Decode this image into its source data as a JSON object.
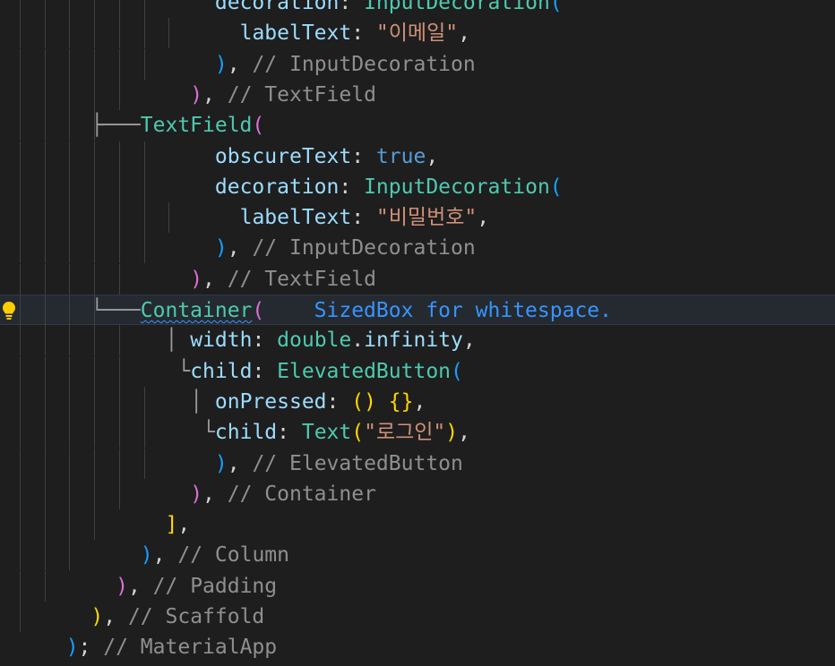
{
  "lines": [
    {
      "indent": 8,
      "guides": [
        1,
        2,
        3,
        4,
        5,
        6
      ],
      "tokens": [
        [
          "k",
          "decoration"
        ],
        [
          "p",
          ": "
        ],
        [
          "t",
          "InputDecoration"
        ],
        [
          "bl",
          "("
        ]
      ]
    },
    {
      "indent": 9,
      "guides": [
        1,
        2,
        3,
        4,
        5,
        6,
        7
      ],
      "tokens": [
        [
          "k",
          "labelText"
        ],
        [
          "p",
          ": "
        ],
        [
          "s",
          "\"이메일\""
        ],
        [
          "p",
          ","
        ]
      ]
    },
    {
      "indent": 8,
      "guides": [
        1,
        2,
        3,
        4,
        5,
        6
      ],
      "tokens": [
        [
          "bl",
          ")"
        ],
        [
          "p",
          ", "
        ],
        [
          "c",
          "// InputDecoration"
        ]
      ]
    },
    {
      "indent": 7,
      "guides": [
        1,
        2,
        3,
        4,
        5
      ],
      "tokens": [
        [
          "m",
          ")"
        ],
        [
          "p",
          ", "
        ],
        [
          "c",
          "// TextField"
        ]
      ]
    },
    {
      "indent": 5,
      "guides": [
        1,
        2,
        3,
        4
      ],
      "tree": "├───",
      "tokens": [
        [
          "t",
          "TextField"
        ],
        [
          "m",
          "("
        ]
      ]
    },
    {
      "indent": 8,
      "guides": [
        1,
        2,
        3,
        4,
        5,
        6
      ],
      "tokens": [
        [
          "k",
          "obscureText"
        ],
        [
          "p",
          ": "
        ],
        [
          "b",
          "true"
        ],
        [
          "p",
          ","
        ]
      ]
    },
    {
      "indent": 8,
      "guides": [
        1,
        2,
        3,
        4,
        5,
        6
      ],
      "tokens": [
        [
          "k",
          "decoration"
        ],
        [
          "p",
          ": "
        ],
        [
          "t",
          "InputDecoration"
        ],
        [
          "bl",
          "("
        ]
      ]
    },
    {
      "indent": 9,
      "guides": [
        1,
        2,
        3,
        4,
        5,
        6,
        7
      ],
      "tokens": [
        [
          "k",
          "labelText"
        ],
        [
          "p",
          ": "
        ],
        [
          "s",
          "\"비밀번호\""
        ],
        [
          "p",
          ","
        ]
      ]
    },
    {
      "indent": 8,
      "guides": [
        1,
        2,
        3,
        4,
        5,
        6
      ],
      "tokens": [
        [
          "bl",
          ")"
        ],
        [
          "p",
          ", "
        ],
        [
          "c",
          "// InputDecoration"
        ]
      ]
    },
    {
      "indent": 7,
      "guides": [
        1,
        2,
        3,
        4,
        5
      ],
      "tokens": [
        [
          "m",
          ")"
        ],
        [
          "p",
          ", "
        ],
        [
          "c",
          "// TextField"
        ]
      ]
    },
    {
      "indent": 5,
      "guides": [
        1,
        2,
        3,
        4
      ],
      "tree": "└───",
      "current": true,
      "bulb": true,
      "tokens": [
        [
          "t squig",
          "Container"
        ],
        [
          "m",
          "("
        ],
        [
          "p",
          "    "
        ],
        [
          "hint",
          "SizedBox for whitespace."
        ]
      ]
    },
    {
      "indent": 7,
      "guides": [
        1,
        2,
        3,
        4,
        5
      ],
      "tree": "│ ",
      "tokens": [
        [
          "k",
          "width"
        ],
        [
          "p",
          ": "
        ],
        [
          "t",
          "double"
        ],
        [
          "p",
          "."
        ],
        [
          "k",
          "infinity"
        ],
        [
          "p",
          ","
        ]
      ]
    },
    {
      "indent": 7,
      "guides": [
        1,
        2,
        3,
        4,
        5
      ],
      "tree": "└",
      "tokens": [
        [
          "k",
          "child"
        ],
        [
          "p",
          ": "
        ],
        [
          "t",
          "ElevatedButton"
        ],
        [
          "bl",
          "("
        ]
      ]
    },
    {
      "indent": 8,
      "guides": [
        1,
        2,
        3,
        4,
        5,
        6
      ],
      "tree": "│ ",
      "tokens": [
        [
          "k",
          "onPressed"
        ],
        [
          "p",
          ": "
        ],
        [
          "y",
          "()"
        ],
        [
          "p",
          " "
        ],
        [
          "y",
          "{}"
        ],
        [
          "p",
          ","
        ]
      ]
    },
    {
      "indent": 8,
      "guides": [
        1,
        2,
        3,
        4,
        5,
        6
      ],
      "tree": "└",
      "tokens": [
        [
          "k",
          "child"
        ],
        [
          "p",
          ": "
        ],
        [
          "t",
          "Text"
        ],
        [
          "y",
          "("
        ],
        [
          "s",
          "\"로그인\""
        ],
        [
          "y",
          ")"
        ],
        [
          "p",
          ","
        ]
      ]
    },
    {
      "indent": 8,
      "guides": [
        1,
        2,
        3,
        4,
        5,
        6
      ],
      "tokens": [
        [
          "bl",
          ")"
        ],
        [
          "p",
          ", "
        ],
        [
          "c",
          "// ElevatedButton"
        ]
      ]
    },
    {
      "indent": 7,
      "guides": [
        1,
        2,
        3,
        4,
        5
      ],
      "tokens": [
        [
          "m",
          ")"
        ],
        [
          "p",
          ", "
        ],
        [
          "c",
          "// Container"
        ]
      ]
    },
    {
      "indent": 6,
      "guides": [
        1,
        2,
        3,
        4
      ],
      "tokens": [
        [
          "y",
          "]"
        ],
        [
          "p",
          ","
        ]
      ]
    },
    {
      "indent": 5,
      "guides": [
        1,
        2,
        3
      ],
      "tokens": [
        [
          "bl",
          ")"
        ],
        [
          "p",
          ", "
        ],
        [
          "c",
          "// Column"
        ]
      ]
    },
    {
      "indent": 4,
      "guides": [
        1,
        2
      ],
      "tokens": [
        [
          "m",
          ")"
        ],
        [
          "p",
          ", "
        ],
        [
          "c",
          "// Padding"
        ]
      ]
    },
    {
      "indent": 3,
      "guides": [
        1
      ],
      "tokens": [
        [
          "y",
          ")"
        ],
        [
          "p",
          ", "
        ],
        [
          "c",
          "// Scaffold"
        ]
      ]
    },
    {
      "indent": 2,
      "guides": [],
      "tokens": [
        [
          "bl",
          ")"
        ],
        [
          "p",
          "; "
        ],
        [
          "c",
          "// MaterialApp"
        ]
      ]
    }
  ],
  "colors": {
    "background": "#1e1e1e",
    "current_line": "#252a30",
    "lightbulb": "#ffcc00"
  },
  "icons": {
    "lightbulb": "lightbulb-icon"
  }
}
